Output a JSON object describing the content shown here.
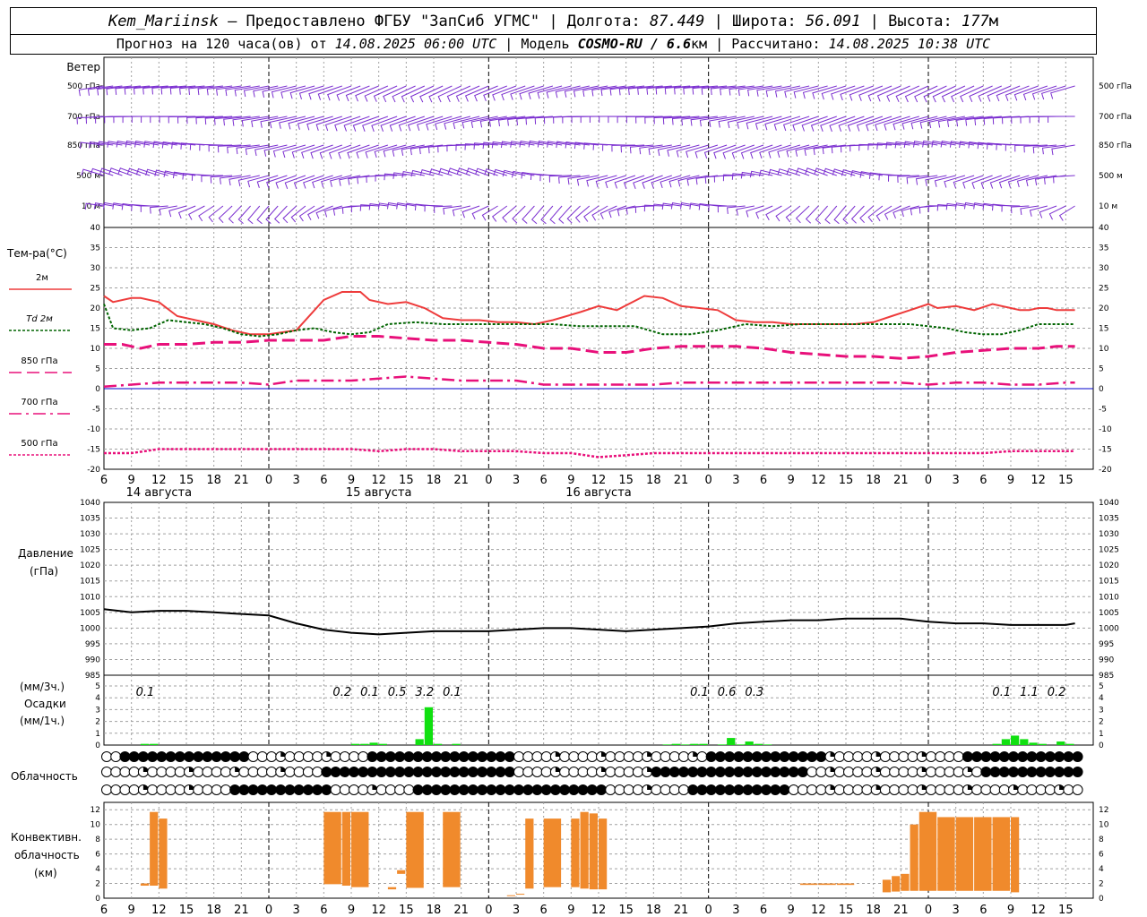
{
  "header": {
    "station": "Kem_Mariinsk",
    "provider": "– Предоставлено ФГБУ \"ЗапСиб УГМС\"",
    "lon_label": "Долгота:",
    "lon": "87.449",
    "lat_label": "Широта:",
    "lat": "56.091",
    "alt_label": "Высота:",
    "alt": "177",
    "alt_unit": "м",
    "forecast_prefix": "Прогноз на 120 часа(ов) от",
    "forecast_start": "14.08.2025 06:00 UTC",
    "model_label": "Модель",
    "model": "COSMO-RU / 6.6",
    "model_unit": "км",
    "calc_label": "Рассчитано:",
    "calc_time": "14.08.2025 10:38 UTC"
  },
  "colors": {
    "wind": "#7b2fd0",
    "t2m": "#ee3c3c",
    "td2m": "#006400",
    "t850": "#e8107a",
    "t700": "#e8107a",
    "t500": "#e8107a",
    "zero_line": "#0000cc",
    "pressure": "#000000",
    "precip": "#10e010",
    "conv": "#f08a2c",
    "grid": "#a0a0a0"
  },
  "wind_panel": {
    "title": "Ветер",
    "levels": [
      "500 гПа",
      "700 гПа",
      "850 гПа",
      "500 м",
      "10  м"
    ]
  },
  "temp_panel": {
    "title": "Тем-ра(°С)",
    "legend": [
      "2м",
      "Td  2м",
      "850 гПа",
      "700 гПа",
      "500 гПа"
    ],
    "yticks": [
      40,
      35,
      30,
      25,
      20,
      15,
      10,
      5,
      0,
      -5,
      -10,
      -15,
      -20
    ]
  },
  "time_axis": {
    "hour_labels": [
      "6",
      "9",
      "12",
      "15",
      "18",
      "21",
      "0",
      "3",
      "6",
      "9",
      "12",
      "15",
      "18",
      "21",
      "0",
      "3",
      "6",
      "9",
      "12",
      "15",
      "18",
      "21",
      "0",
      "3",
      "6",
      "9",
      "12"
    ],
    "days": [
      "14 августа",
      "15 августа",
      "16 августа"
    ]
  },
  "pressure_panel": {
    "title": "Давление",
    "unit": "(гПа)",
    "yticks": [
      1040,
      1035,
      1030,
      1025,
      1020,
      1015,
      1010,
      1005,
      1000,
      995,
      990,
      985
    ]
  },
  "precip_panel": {
    "title1": "(мм/3ч.)",
    "title2": "Осадки",
    "title3": "(мм/1ч.)",
    "yticks": [
      5,
      4,
      3,
      2,
      1,
      0
    ],
    "annotations": [
      {
        "h": 10.5,
        "text": "0.1"
      },
      {
        "h": 32,
        "text": "0.2"
      },
      {
        "h": 35,
        "text": "0.1"
      },
      {
        "h": 38,
        "text": "0.5"
      },
      {
        "h": 41,
        "text": "3.2"
      },
      {
        "h": 44,
        "text": "0.1"
      },
      {
        "h": 71,
        "text": "0.1"
      },
      {
        "h": 74,
        "text": "0.6"
      },
      {
        "h": 77,
        "text": "0.3"
      },
      {
        "h": 104,
        "text": "0.1"
      },
      {
        "h": 107,
        "text": "1.1"
      },
      {
        "h": 110,
        "text": "0.2"
      }
    ]
  },
  "cloud_panel": {
    "title": "Облачность"
  },
  "conv_panel": {
    "title1": "Конвективн.",
    "title2": "облачность",
    "title3": "(км)",
    "yticks": [
      12,
      10,
      8,
      6,
      4,
      2,
      0
    ]
  },
  "chart_data": [
    {
      "type": "line",
      "title": "Тем-ра(°С)",
      "x_unit": "hours since 14.08.2025 00:00 UTC",
      "ylim": [
        -20,
        40
      ],
      "series": [
        {
          "name": "2м",
          "x": [
            6,
            7,
            9,
            10,
            12,
            14,
            16,
            18,
            20,
            22,
            24,
            27,
            30,
            32,
            34,
            35,
            37,
            39,
            41,
            43,
            45,
            47,
            49,
            51,
            53,
            55,
            58,
            60,
            62,
            65,
            67,
            69,
            71,
            73,
            75,
            77,
            79,
            81,
            83,
            86,
            88,
            90,
            92,
            94,
            96,
            97,
            99,
            101,
            103,
            105,
            106,
            107,
            108,
            109,
            110,
            111,
            112
          ],
          "y": [
            23,
            21.5,
            22.5,
            22.5,
            21.5,
            18,
            17,
            16,
            14.5,
            13.5,
            13.5,
            14.5,
            22,
            24,
            24,
            22,
            21,
            21.5,
            20,
            17.5,
            17,
            17,
            16.5,
            16.5,
            16,
            17,
            19,
            20.5,
            19.5,
            23,
            22.5,
            20.5,
            20,
            19.5,
            17,
            16.5,
            16.5,
            16,
            16,
            16,
            16,
            16.5,
            18,
            19.5,
            21,
            20,
            20.5,
            19.5,
            21,
            20,
            19.5,
            19.5,
            20,
            20,
            19.5,
            19.5,
            19.5
          ]
        },
        {
          "name": "Td  2м",
          "x": [
            6,
            7,
            9,
            11,
            13,
            15,
            17,
            19,
            21,
            23,
            25,
            27,
            29,
            31,
            33,
            35,
            37,
            40,
            43,
            46,
            49,
            52,
            55,
            58,
            61,
            64,
            67,
            70,
            73,
            76,
            79,
            82,
            85,
            88,
            91,
            94,
            96,
            98,
            100,
            102,
            104,
            106,
            108,
            110,
            112
          ],
          "y": [
            21,
            15,
            14.5,
            15,
            17,
            16.5,
            16,
            15,
            13.5,
            13,
            13.5,
            14.5,
            15,
            14,
            13.5,
            14,
            16,
            16.5,
            16,
            16,
            16,
            16,
            16,
            15.5,
            15.5,
            15.5,
            13.5,
            13.5,
            14.5,
            16,
            15.5,
            16,
            16,
            16,
            16,
            16,
            15.5,
            15,
            14,
            13.5,
            13.5,
            14.5,
            16,
            16,
            16
          ]
        },
        {
          "name": "850 гПа",
          "x": [
            6,
            8,
            10,
            12,
            15,
            18,
            21,
            24,
            27,
            30,
            33,
            36,
            39,
            42,
            45,
            48,
            51,
            54,
            57,
            60,
            63,
            66,
            69,
            72,
            75,
            78,
            81,
            84,
            87,
            90,
            93,
            96,
            99,
            102,
            105,
            108,
            110,
            112
          ],
          "y": [
            11,
            11,
            10,
            11,
            11,
            11.5,
            11.5,
            12,
            12,
            12,
            13,
            13,
            12.5,
            12,
            12,
            11.5,
            11,
            10,
            10,
            9,
            9,
            10,
            10.5,
            10.5,
            10.5,
            10,
            9,
            8.5,
            8,
            8,
            7.5,
            8,
            9,
            9.5,
            10,
            10,
            10.5,
            10.5
          ]
        },
        {
          "name": "700 гПа",
          "x": [
            6,
            9,
            12,
            15,
            18,
            21,
            24,
            27,
            30,
            33,
            36,
            39,
            42,
            45,
            48,
            51,
            54,
            57,
            60,
            63,
            66,
            69,
            72,
            75,
            78,
            81,
            84,
            87,
            90,
            93,
            96,
            99,
            102,
            105,
            108,
            111,
            112
          ],
          "y": [
            0.5,
            1,
            1.5,
            1.5,
            1.5,
            1.5,
            1,
            2,
            2,
            2,
            2.5,
            3,
            2.5,
            2,
            2,
            2,
            1,
            1,
            1,
            1,
            1,
            1.5,
            1.5,
            1.5,
            1.5,
            1.5,
            1.5,
            1.5,
            1.5,
            1.5,
            1,
            1.5,
            1.5,
            1,
            1,
            1.5,
            1.5
          ]
        },
        {
          "name": "500 гПа",
          "x": [
            6,
            9,
            12,
            15,
            18,
            21,
            24,
            27,
            30,
            33,
            36,
            39,
            42,
            45,
            48,
            51,
            54,
            57,
            60,
            63,
            66,
            69,
            72,
            75,
            78,
            81,
            84,
            87,
            90,
            93,
            96,
            99,
            102,
            105,
            108,
            111,
            112
          ],
          "y": [
            -16,
            -16,
            -15,
            -15,
            -15,
            -15,
            -15,
            -15,
            -15,
            -15,
            -15.5,
            -15,
            -15,
            -15.5,
            -15.5,
            -15.5,
            -16,
            -16,
            -17,
            -16.5,
            -16,
            -16,
            -16,
            -16,
            -16,
            -16,
            -16,
            -16,
            -16,
            -16,
            -16,
            -16,
            -16,
            -15.5,
            -15.5,
            -15.5,
            -15.5
          ]
        }
      ]
    },
    {
      "type": "line",
      "title": "Давление",
      "ylim": [
        985,
        1040
      ],
      "series": [
        {
          "name": "Давление",
          "x": [
            6,
            9,
            12,
            15,
            18,
            21,
            24,
            27,
            30,
            33,
            36,
            39,
            42,
            45,
            48,
            51,
            54,
            57,
            60,
            63,
            66,
            69,
            72,
            75,
            78,
            81,
            84,
            87,
            90,
            93,
            96,
            99,
            102,
            105,
            108,
            111,
            112
          ],
          "y": [
            1006,
            1005,
            1005.5,
            1005.5,
            1005,
            1004.5,
            1004,
            1001.5,
            999.5,
            998.5,
            998,
            998.5,
            999,
            999,
            999,
            999.5,
            1000,
            1000,
            999.5,
            999,
            999.5,
            1000,
            1000.5,
            1001.5,
            1002,
            1002.5,
            1002.5,
            1003,
            1003,
            1003,
            1002,
            1001.5,
            1001.5,
            1001,
            1001,
            1001,
            1001.5
          ]
        }
      ]
    },
    {
      "type": "bar",
      "title": "Осадки",
      "ylim": [
        0,
        5
      ],
      "x": [
        10,
        11,
        33,
        34,
        35,
        36,
        40,
        41,
        42,
        44,
        67,
        68,
        69,
        70,
        71,
        73,
        74,
        75,
        76,
        77,
        78,
        103,
        104,
        105,
        106,
        107,
        108,
        110,
        111
      ],
      "values": [
        0.1,
        0.1,
        0.1,
        0.1,
        0.2,
        0.1,
        0.5,
        3.2,
        0.1,
        0.1,
        0.05,
        0.1,
        0.05,
        0.1,
        0.1,
        0.05,
        0.6,
        0.05,
        0.3,
        0.1,
        0.05,
        0.1,
        0.5,
        0.8,
        0.5,
        0.2,
        0.1,
        0.3,
        0.1
      ]
    },
    {
      "type": "bar",
      "title": "Конвективн. облачность",
      "ylim": [
        0,
        13
      ],
      "bars": [
        [
          10,
          11,
          1.7,
          2.0
        ],
        [
          11,
          12,
          1.7,
          11.7
        ],
        [
          12,
          13,
          1.3,
          10.8
        ],
        [
          30,
          32,
          1.9,
          11.7
        ],
        [
          32,
          33,
          1.7,
          11.7
        ],
        [
          33,
          35,
          1.5,
          11.7
        ],
        [
          37,
          38,
          1.2,
          1.5
        ],
        [
          38,
          39,
          3.3,
          3.8
        ],
        [
          39,
          41,
          1.4,
          11.7
        ],
        [
          43,
          45,
          1.5,
          11.7
        ],
        [
          50,
          51,
          0.3,
          0.4
        ],
        [
          51,
          52,
          0.5,
          0.6
        ],
        [
          52,
          53,
          1.3,
          10.8
        ],
        [
          54,
          56,
          1.5,
          10.8
        ],
        [
          57,
          58,
          1.5,
          10.8
        ],
        [
          58,
          59,
          1.3,
          11.7
        ],
        [
          59,
          60,
          1.2,
          11.5
        ],
        [
          60,
          61,
          1.2,
          10.8
        ],
        [
          82,
          84,
          1.8,
          2.0
        ],
        [
          84,
          86,
          1.8,
          2.0
        ],
        [
          86,
          88,
          1.8,
          2.0
        ],
        [
          91,
          92,
          0.8,
          2.5
        ],
        [
          92,
          93,
          0.9,
          3.0
        ],
        [
          93,
          94,
          1.0,
          3.3
        ],
        [
          94,
          95,
          1.0,
          10.0
        ],
        [
          95,
          97,
          1.0,
          11.7
        ],
        [
          97,
          99,
          1.0,
          11.0
        ],
        [
          99,
          101,
          1.0,
          11.0
        ],
        [
          101,
          103,
          1.0,
          11.0
        ],
        [
          103,
          105,
          1.0,
          11.0
        ],
        [
          105,
          106,
          0.8,
          11.0
        ]
      ]
    }
  ]
}
